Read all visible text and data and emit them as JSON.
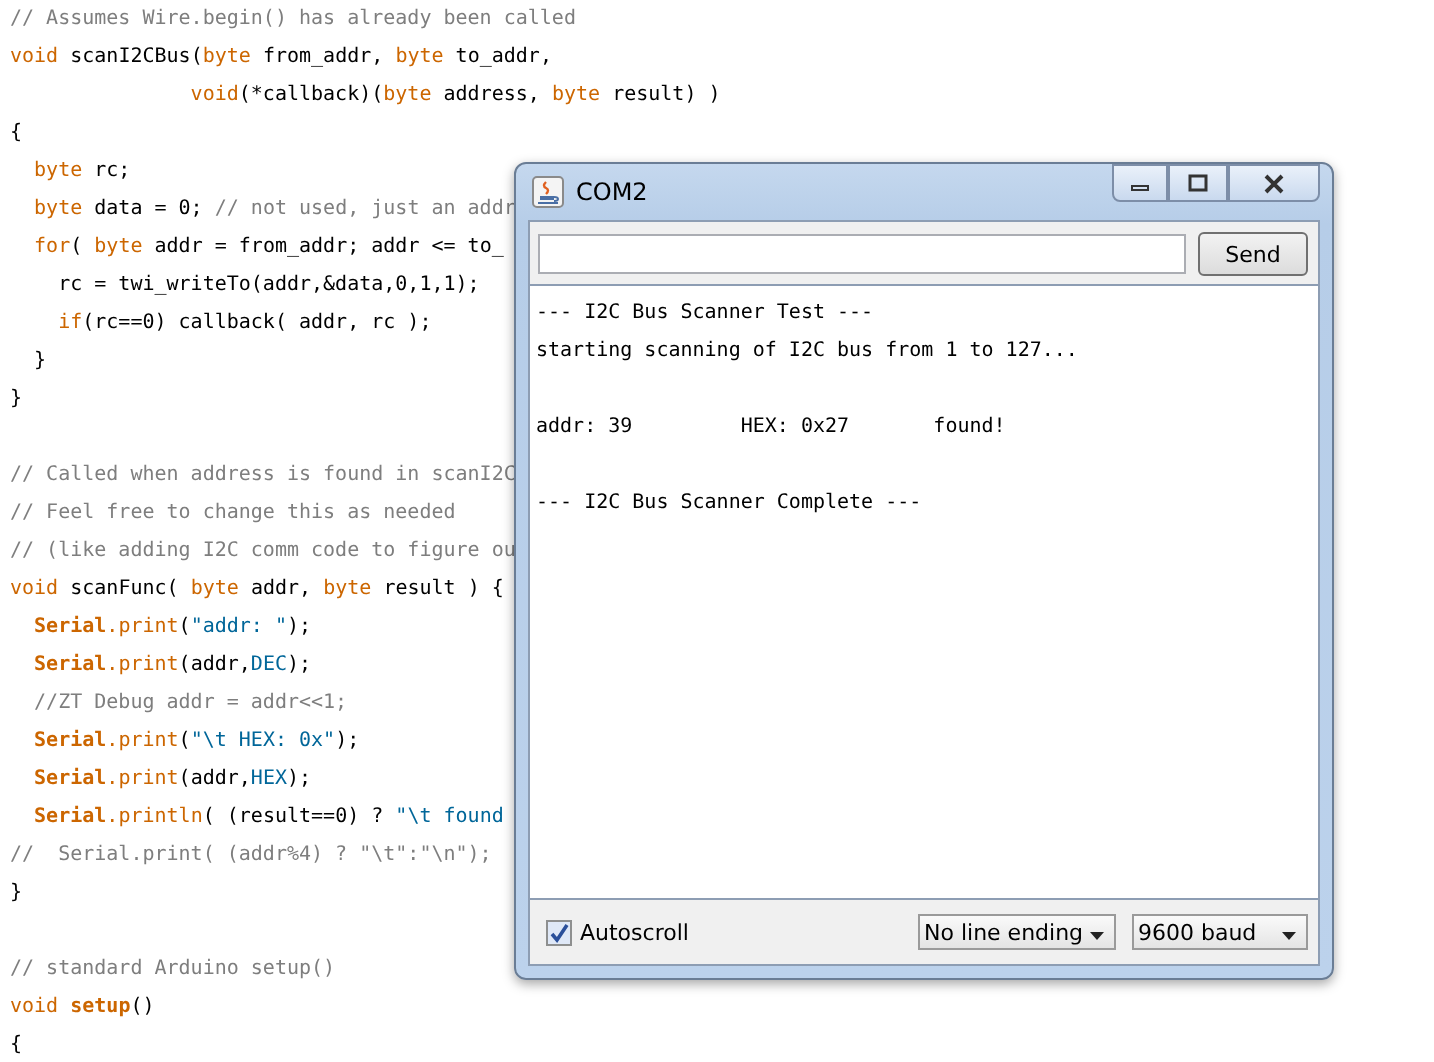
{
  "editor": {
    "lines": [
      {
        "tokens": [
          {
            "kind": "comment",
            "text": "// Assumes Wire.begin() has already been called"
          }
        ]
      },
      {
        "tokens": [
          {
            "kind": "keyword",
            "text": "void"
          },
          {
            "kind": "plain",
            "text": " scanI2CBus("
          },
          {
            "kind": "keyword",
            "text": "byte"
          },
          {
            "kind": "plain",
            "text": " from_addr, "
          },
          {
            "kind": "keyword",
            "text": "byte"
          },
          {
            "kind": "plain",
            "text": " to_addr,"
          }
        ]
      },
      {
        "tokens": [
          {
            "kind": "keyword",
            "text": "               void"
          },
          {
            "kind": "plain",
            "text": "(*callback)("
          },
          {
            "kind": "keyword",
            "text": "byte"
          },
          {
            "kind": "plain",
            "text": " address, "
          },
          {
            "kind": "keyword",
            "text": "byte"
          },
          {
            "kind": "plain",
            "text": " result) )"
          }
        ]
      },
      {
        "tokens": [
          {
            "kind": "plain",
            "text": "{"
          }
        ]
      },
      {
        "tokens": [
          {
            "kind": "keyword",
            "text": "  byte"
          },
          {
            "kind": "plain",
            "text": " rc;"
          }
        ]
      },
      {
        "tokens": [
          {
            "kind": "keyword",
            "text": "  byte"
          },
          {
            "kind": "plain",
            "text": " data = 0; "
          },
          {
            "kind": "comment",
            "text": "// not used, just an addr"
          }
        ]
      },
      {
        "tokens": [
          {
            "kind": "keyword",
            "text": "  for"
          },
          {
            "kind": "plain",
            "text": "( "
          },
          {
            "kind": "keyword",
            "text": "byte"
          },
          {
            "kind": "plain",
            "text": " addr = from_addr; addr <= to_"
          }
        ]
      },
      {
        "tokens": [
          {
            "kind": "plain",
            "text": "    rc = twi_writeTo(addr,&data,0,1,1);"
          }
        ]
      },
      {
        "tokens": [
          {
            "kind": "keyword",
            "text": "    if"
          },
          {
            "kind": "plain",
            "text": "(rc==0) callback( addr, rc );"
          }
        ]
      },
      {
        "tokens": [
          {
            "kind": "plain",
            "text": "  }"
          }
        ]
      },
      {
        "tokens": [
          {
            "kind": "plain",
            "text": "}"
          }
        ]
      },
      {
        "kind": "blank"
      },
      {
        "kind": "code",
        "tokens": [
          {
            "kind": "comment",
            "text": "// Called when address is found in scanI2C"
          }
        ]
      },
      {
        "tokens": [
          {
            "kind": "comment",
            "text": "// Feel free to change this as needed"
          }
        ]
      },
      {
        "tokens": [
          {
            "kind": "comment",
            "text": "// (like adding I2C comm code to figure ou"
          }
        ]
      },
      {
        "tokens": [
          {
            "kind": "keyword",
            "text": "void"
          },
          {
            "kind": "plain",
            "text": " scanFunc( "
          },
          {
            "kind": "keyword",
            "text": "byte"
          },
          {
            "kind": "plain",
            "text": " addr, "
          },
          {
            "kind": "keyword",
            "text": "byte"
          },
          {
            "kind": "plain",
            "text": " result ) {"
          }
        ]
      },
      {
        "tokens": [
          {
            "kind": "class",
            "text": "  Serial"
          },
          {
            "kind": "keyword",
            "text": ".print"
          },
          {
            "kind": "plain",
            "text": "("
          },
          {
            "kind": "string",
            "text": "\"addr: \""
          },
          {
            "kind": "plain",
            "text": ");"
          }
        ]
      },
      {
        "tokens": [
          {
            "kind": "class",
            "text": "  Serial"
          },
          {
            "kind": "keyword",
            "text": ".print"
          },
          {
            "kind": "plain",
            "text": "(addr,"
          },
          {
            "kind": "string",
            "text": "DEC"
          },
          {
            "kind": "plain",
            "text": ");"
          }
        ]
      },
      {
        "tokens": [
          {
            "kind": "comment",
            "text": "  //ZT Debug addr = addr<<1;"
          }
        ]
      },
      {
        "tokens": [
          {
            "kind": "class",
            "text": "  Serial"
          },
          {
            "kind": "keyword",
            "text": ".print"
          },
          {
            "kind": "plain",
            "text": "("
          },
          {
            "kind": "string",
            "text": "\"\\t HEX: 0x\""
          },
          {
            "kind": "plain",
            "text": ");"
          }
        ]
      },
      {
        "tokens": [
          {
            "kind": "class",
            "text": "  Serial"
          },
          {
            "kind": "keyword",
            "text": ".print"
          },
          {
            "kind": "plain",
            "text": "(addr,"
          },
          {
            "kind": "string",
            "text": "HEX"
          },
          {
            "kind": "plain",
            "text": ");"
          }
        ]
      },
      {
        "tokens": [
          {
            "kind": "class",
            "text": "  Serial"
          },
          {
            "kind": "keyword",
            "text": ".println"
          },
          {
            "kind": "plain",
            "text": "( (result==0) ? "
          },
          {
            "kind": "string",
            "text": "\"\\t found"
          }
        ]
      },
      {
        "tokens": [
          {
            "kind": "comment",
            "text": "//  Serial.print( (addr%4) ? \"\\t\":\"\\n\");"
          }
        ]
      },
      {
        "tokens": [
          {
            "kind": "plain",
            "text": "}"
          }
        ]
      },
      {
        "kind": "blank"
      },
      {
        "kind": "code",
        "tokens": [
          {
            "kind": "comment",
            "text": "// standard Arduino setup()"
          }
        ]
      },
      {
        "tokens": [
          {
            "kind": "keyword",
            "text": "void "
          },
          {
            "kind": "class",
            "text": "setup"
          },
          {
            "kind": "plain",
            "text": "()"
          }
        ]
      },
      {
        "tokens": [
          {
            "kind": "plain",
            "text": "{"
          }
        ]
      }
    ]
  },
  "window": {
    "title": "COM2",
    "send_button": "Send",
    "output": [
      {
        "text": "--- I2C Bus Scanner Test ---"
      },
      {
        "text": "starting scanning of I2C bus from 1 to 127..."
      },
      {
        "kind": "blank"
      },
      {
        "kind": "text",
        "text": "addr: 39         HEX: 0x27       found!"
      },
      {
        "kind": "blank"
      },
      {
        "kind": "text",
        "text": "--- I2C Bus Scanner Complete ---"
      }
    ],
    "autoscroll": {
      "label": "Autoscroll",
      "checked": true
    },
    "line_ending": "No line ending",
    "baud": "9600 baud"
  }
}
